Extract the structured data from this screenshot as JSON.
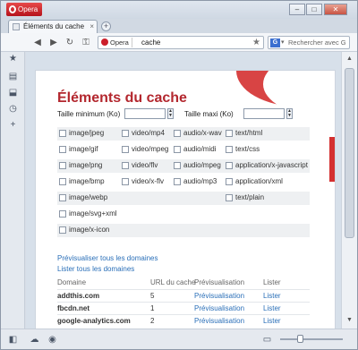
{
  "window": {
    "opera_button_label": "Opera",
    "controls": [
      "–",
      "□",
      "✕"
    ]
  },
  "tab": {
    "title": "Éléments du cache",
    "close": "×",
    "new_tab": "+"
  },
  "toolbar": {
    "address_badge": "Opera",
    "address_url": "cache",
    "search_engine": "G",
    "search_placeholder": "Rechercher avec G"
  },
  "page": {
    "title": "Éléments du cache",
    "min_size_label": "Taille minimum (Ko)",
    "max_size_label": "Taille maxi (Ko)",
    "min_size_value": "",
    "max_size_value": "",
    "types": [
      [
        "image/jpeg",
        "video/mp4",
        "audio/x-wav",
        "text/html"
      ],
      [
        "image/gif",
        "video/mpeg",
        "audio/midi",
        "text/css"
      ],
      [
        "image/png",
        "video/flv",
        "audio/mpeg",
        "application/x-javascript"
      ],
      [
        "image/bmp",
        "video/x-flv",
        "audio/mp3",
        "application/xml"
      ],
      [
        "image/webp",
        "",
        "",
        "text/plain"
      ],
      [
        "image/svg+xml",
        "",
        "",
        ""
      ],
      [
        "image/x-icon",
        "",
        "",
        ""
      ]
    ],
    "preview_all_link": "Prévisualiser tous les domaines",
    "list_all_link": "Lister tous les domaines",
    "table": {
      "headers": [
        "Domaine",
        "URL du cache",
        "Prévisualisation",
        "Lister"
      ],
      "rows": [
        [
          "addthis.com",
          "5",
          "Prévisualisation",
          "Lister"
        ],
        [
          "fbcdn.net",
          "1",
          "Prévisualisation",
          "Lister"
        ],
        [
          "google-analytics.com",
          "2",
          "Prévisualisation",
          "Lister"
        ]
      ]
    }
  },
  "colors": {
    "accent": "#b3272e",
    "link": "#2a6fb8"
  },
  "sidebar": {
    "icons": [
      "star-icon",
      "notes-icon",
      "downloads-icon",
      "history-icon",
      "add-panel-icon"
    ]
  },
  "statusbar": {
    "icons": [
      "panel-toggle-icon",
      "cloud-icon",
      "speed-dial-icon",
      "view-icon"
    ]
  }
}
